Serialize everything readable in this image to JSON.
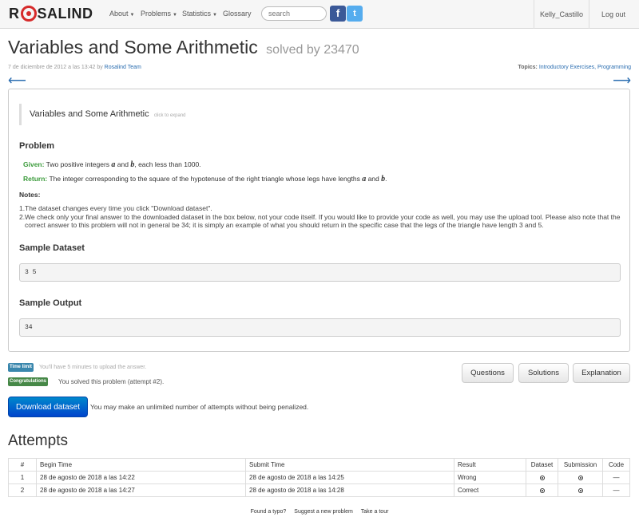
{
  "nav": {
    "logo_prefix": "R",
    "logo_suffix": "SALIND",
    "about": "About",
    "problems": "Problems",
    "statistics": "Statistics",
    "glossary": "Glossary",
    "search_placeholder": "search",
    "facebook": "f",
    "twitter": "t",
    "user": "Kelly_Castillo",
    "logout": "Log out"
  },
  "header": {
    "title": "Variables and Some Arithmetic",
    "solved_by": "solved by 23470",
    "date": "7 de diciembre de 2012 a las 13:42",
    "by": "by",
    "author": "Rosalind Team",
    "topics_label": "Topics:",
    "topics": "Introductory Exercises, Programming",
    "prev_arrow": "⟵",
    "next_arrow": "⟶"
  },
  "problem": {
    "quote_title": "Variables and Some Arithmetic",
    "quote_expand": "click to expand",
    "heading": "Problem",
    "given_label": "Given:",
    "given_pre": "Two positive integers",
    "given_a": "a",
    "given_and": "and",
    "given_b": "b",
    "given_post": ", each less than 1000.",
    "return_label": "Return:",
    "return_pre": "The integer corresponding to the square of the hypotenuse of the right triangle whose legs have lengths",
    "return_a": "a",
    "return_and": "and",
    "return_b": "b",
    "return_post": ".",
    "notes_heading": "Notes:",
    "note1": "The dataset changes every time you click \"Download dataset\".",
    "note2": "We check only your final answer to the downloaded dataset in the box below, not your code itself. If you would like to provide your code as well, you may use the upload tool. Please also note that the correct answer to this problem will not in general be 34; it is simply an example of what you should return in the specific case that the legs of the triangle have length 3 and 5.",
    "sample_dataset_heading": "Sample Dataset",
    "sample_dataset": "3 5",
    "sample_output_heading": "Sample Output",
    "sample_output": "34"
  },
  "status": {
    "time_limit_badge": "Time limit",
    "time_limit_text": "You'll have 5 minutes to upload the answer.",
    "congrats_badge": "Congratulations",
    "congrats_text": "You solved this problem (attempt #2).",
    "questions": "Questions",
    "solutions": "Solutions",
    "explanation": "Explanation",
    "download": "Download dataset",
    "download_note": "You may make an unlimited number of attempts without being penalized."
  },
  "attempts": {
    "heading": "Attempts",
    "columns": [
      "#",
      "Begin Time",
      "Submit Time",
      "Result",
      "Dataset",
      "Submission",
      "Code"
    ],
    "rows": [
      {
        "n": "1",
        "begin": "28 de agosto de 2018 a las 14:22",
        "submit": "28 de agosto de 2018 a las 14:25",
        "result": "Wrong",
        "code": "—"
      },
      {
        "n": "2",
        "begin": "28 de agosto de 2018 a las 14:27",
        "submit": "28 de agosto de 2018 a las 14:28",
        "result": "Correct",
        "code": "—"
      }
    ]
  },
  "footer": {
    "typo": "Found a typo?",
    "suggest": "Suggest a new problem",
    "tour": "Take a tour"
  }
}
